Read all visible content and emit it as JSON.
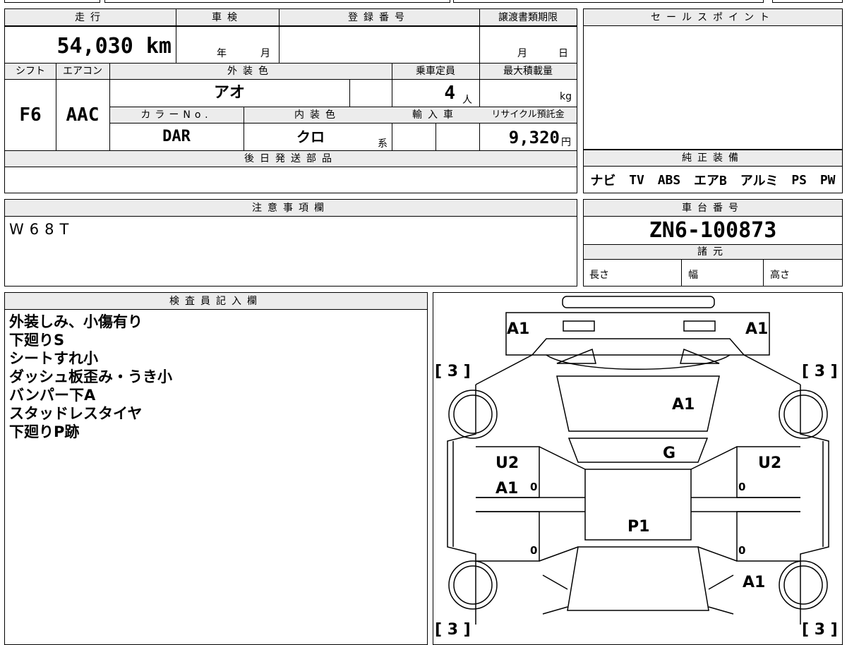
{
  "spec": {
    "mileage_label": "走行",
    "mileage": "54,030",
    "mileage_unit": "km",
    "inspection_label": "車検",
    "inspection_year": "年",
    "inspection_month": "月",
    "reg_label": "登録番号",
    "reg_value": "",
    "transfer_label": "譲渡書類期限",
    "transfer_month": "月",
    "transfer_day": "日",
    "shift_label": "シフト",
    "shift": "F6",
    "ac_label": "エアコン",
    "ac": "AAC",
    "exterior_label": "外装色",
    "exterior": "アオ",
    "capacity_label": "乗車定員",
    "capacity": "4",
    "capacity_unit": "人",
    "maxload_label": "最大積載量",
    "maxload_unit": "kg",
    "colorno_label": "カラーNo.",
    "colorno": "DAR",
    "interior_label": "内装色",
    "interior": "クロ",
    "interior_suffix": "系",
    "import_label": "輸入車",
    "recycle_label": "リサイクル預託金",
    "recycle": "9,320",
    "recycle_unit": "円",
    "later_parts_label": "後日発送部品"
  },
  "sales_point": {
    "label": "セールスポイント"
  },
  "equipment": {
    "label": "純正装備",
    "items": [
      "ナビ",
      "TV",
      "ABS",
      "エアB",
      "アルミ",
      "PS",
      "PW"
    ]
  },
  "caution": {
    "label": "注意事項欄",
    "text": "W68T"
  },
  "chassis": {
    "label": "車台番号",
    "value": "ZN6-100873",
    "specs_label": "諸元",
    "length": "長さ",
    "width": "幅",
    "height": "高さ"
  },
  "inspector": {
    "label": "検査員記入欄",
    "notes": [
      "外装しみ、小傷有り",
      "下廻りS",
      "シートすれ小",
      "ダッシュ板歪み・うき小",
      "バンパー下A",
      "スタッドレスタイヤ",
      "下廻りP跡"
    ]
  },
  "diagram": {
    "marks": [
      "A1",
      "A1",
      "[ 3 ]",
      "[ 3 ]",
      "A1",
      "G",
      "U2",
      "U2",
      "A1",
      "P1",
      "A1",
      "[ 3 ]",
      "[ 3 ]"
    ],
    "zeros": [
      "0",
      "0",
      "0",
      "0"
    ]
  }
}
